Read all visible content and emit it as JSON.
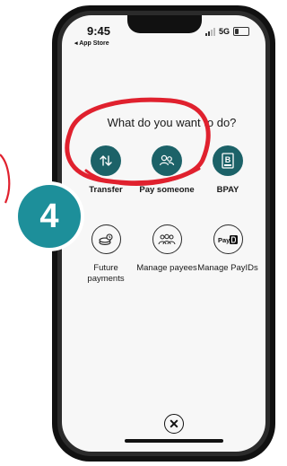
{
  "status_bar": {
    "time": "9:45",
    "back_label": "◂ App Store",
    "network": "5G"
  },
  "screen": {
    "prompt": "What do you want to do?",
    "options_row1": [
      {
        "label": "Transfer",
        "icon": "transfer-arrows-icon"
      },
      {
        "label": "Pay someone",
        "icon": "people-icon"
      },
      {
        "label": "BPAY",
        "icon": "bpay-icon"
      }
    ],
    "options_row2": [
      {
        "label": "Future payments",
        "icon": "coin-clock-icon"
      },
      {
        "label": "Manage payees",
        "icon": "group-icon"
      },
      {
        "label": "Manage PayIDs",
        "icon": "payid-icon"
      }
    ],
    "payid_text": "Pay",
    "bpay_mark": "B",
    "close_icon": "close-icon"
  },
  "annotation": {
    "step_number": "4",
    "highlight_color": "#e0212e",
    "badge_color": "#1d8f9a"
  },
  "colors": {
    "accent": "#1c6268"
  }
}
